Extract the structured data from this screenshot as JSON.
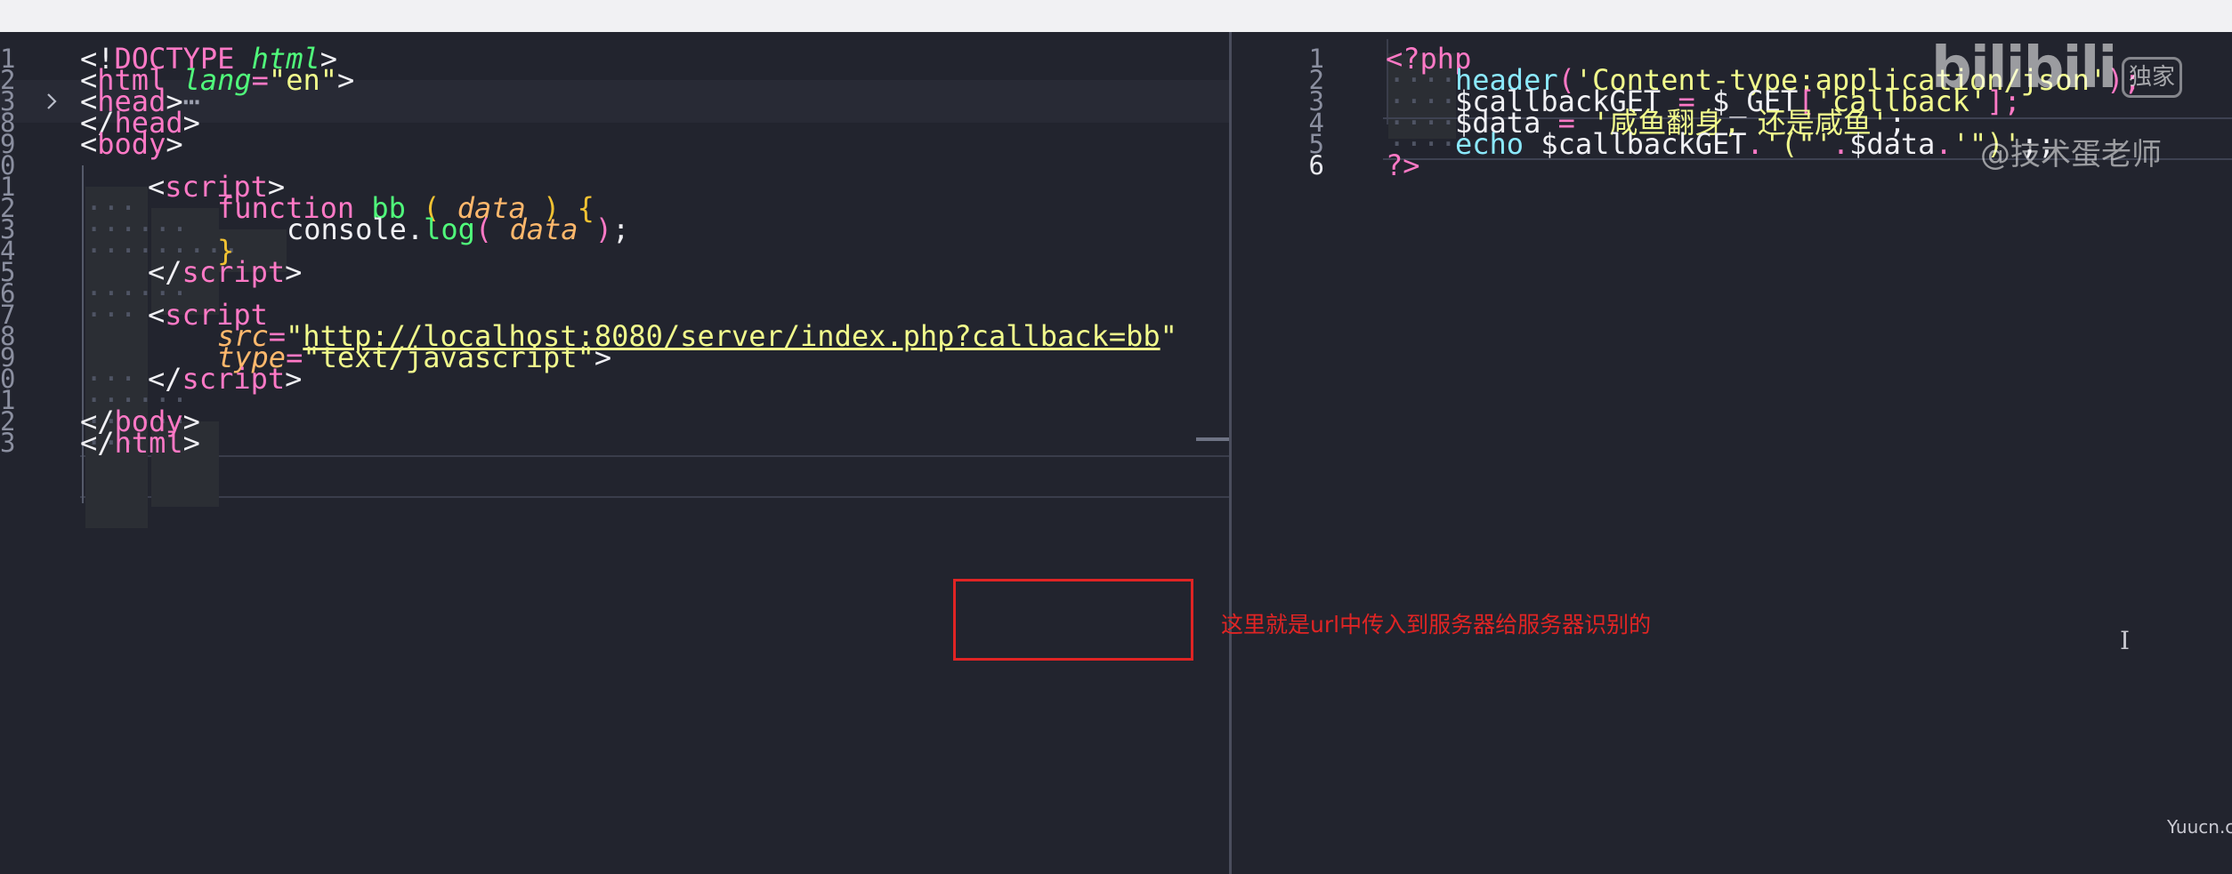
{
  "left_editor": {
    "line_numbers": [
      "1",
      "2",
      "3",
      "8",
      "9",
      "0",
      "1",
      "2",
      "3",
      "4",
      "5",
      "6",
      "7",
      "8",
      "9",
      "0",
      "1",
      "2",
      "3"
    ],
    "fold_icon": "chevron-right-icon",
    "fold_ellipsis": "⋯",
    "lines": {
      "l1": [
        "<!",
        "DOCTYPE",
        " ",
        "html",
        ">"
      ],
      "l2": [
        "<",
        "html",
        " ",
        "lang",
        "=",
        "\"en\"",
        ">"
      ],
      "l3": [
        "<",
        "head",
        ">"
      ],
      "l8": [
        "</",
        "head",
        ">"
      ],
      "l9": [
        "<",
        "body",
        ">"
      ],
      "l11": [
        "<",
        "script",
        ">"
      ],
      "l12": [
        "function",
        " ",
        "bb",
        " ",
        "(",
        " ",
        "data",
        " ",
        ")",
        " ",
        "{"
      ],
      "l13": [
        "console",
        ".",
        "log",
        "(",
        " ",
        "data",
        " ",
        ")",
        ";"
      ],
      "l14": [
        "}"
      ],
      "l15": [
        "</",
        "script",
        ">"
      ],
      "l17": [
        "<",
        "script"
      ],
      "l18": [
        "src",
        "=",
        "\"",
        "http://localhost:8080/server/index.php?callback=bb",
        "\""
      ],
      "l19": [
        "type",
        "=",
        "\"text/javascript\"",
        ">"
      ],
      "l20": [
        "</",
        "script",
        ">"
      ],
      "l22": [
        "</",
        "body",
        ">"
      ],
      "l23": [
        "</",
        "html",
        ">"
      ]
    }
  },
  "right_editor": {
    "line_numbers": [
      "1",
      "2",
      "3",
      "4",
      "5",
      "6"
    ],
    "lines": {
      "r1": [
        "<?",
        "php"
      ],
      "r2": [
        "header",
        "(",
        "'Content-type:application/json'",
        ");"
      ],
      "r3": [
        "$callbackGET",
        " ",
        "=",
        " ",
        "$_GET",
        "[",
        "'callback'",
        "];"
      ],
      "r4": [
        "$data",
        " ",
        "=",
        " ",
        "'咸鱼翻身, 还是咸鱼'",
        ";"
      ],
      "r5": [
        "echo",
        " ",
        "$callbackGET",
        ".",
        "'(\"'",
        ".",
        "$data",
        ".",
        "'\")'",
        ";;"
      ],
      "r6": [
        "?>"
      ]
    }
  },
  "annotation": {
    "text": "这里就是url中传入到服务器给服务器识别的",
    "color": "#e02424"
  },
  "watermark": {
    "logo": "bilibili",
    "badge": "独家",
    "author": "@技术蛋老师"
  },
  "corner_mark": "Yuucn.com",
  "colors": {
    "background": "#22242e",
    "tag": "#ff79c6",
    "attribute": "#ffb86c",
    "string": "#f1fa8c",
    "function": "#50fa7b",
    "php_builtin": "#8be9fd"
  }
}
